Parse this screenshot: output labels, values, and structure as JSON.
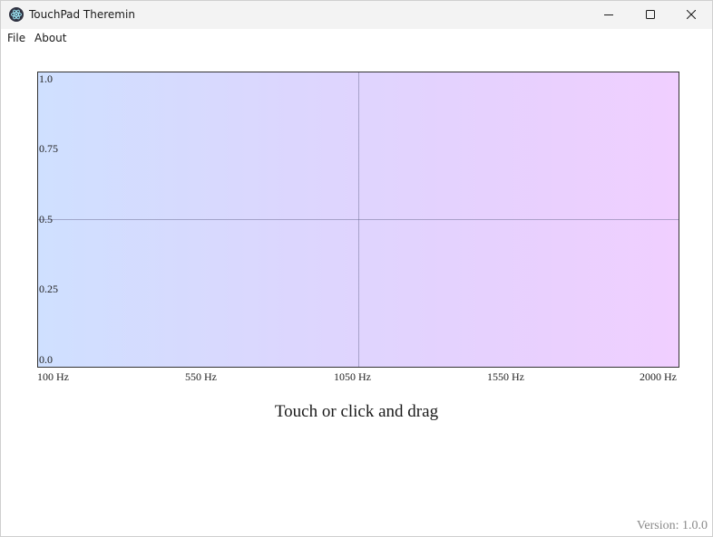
{
  "window": {
    "title": "TouchPad Theremin",
    "icon": "electron-app-icon",
    "controls": [
      "minimize-icon",
      "maximize-icon",
      "close-icon"
    ]
  },
  "menu": {
    "items": [
      {
        "label": "File"
      },
      {
        "label": "About"
      }
    ]
  },
  "pad": {
    "y_ticks": [
      "1.0",
      "0.75",
      "0.5",
      "0.25",
      "0.0"
    ],
    "x_ticks": [
      "100 Hz",
      "550 Hz",
      "1050 Hz",
      "1550 Hz",
      "2000 Hz"
    ],
    "gradient_colors": [
      "#cfe0ff",
      "#f0cfff"
    ],
    "crosshair": {
      "frequency_hz": 1050,
      "amplitude": 0.5
    }
  },
  "instruction": "Touch or click and drag",
  "version": "Version: 1.0.0"
}
